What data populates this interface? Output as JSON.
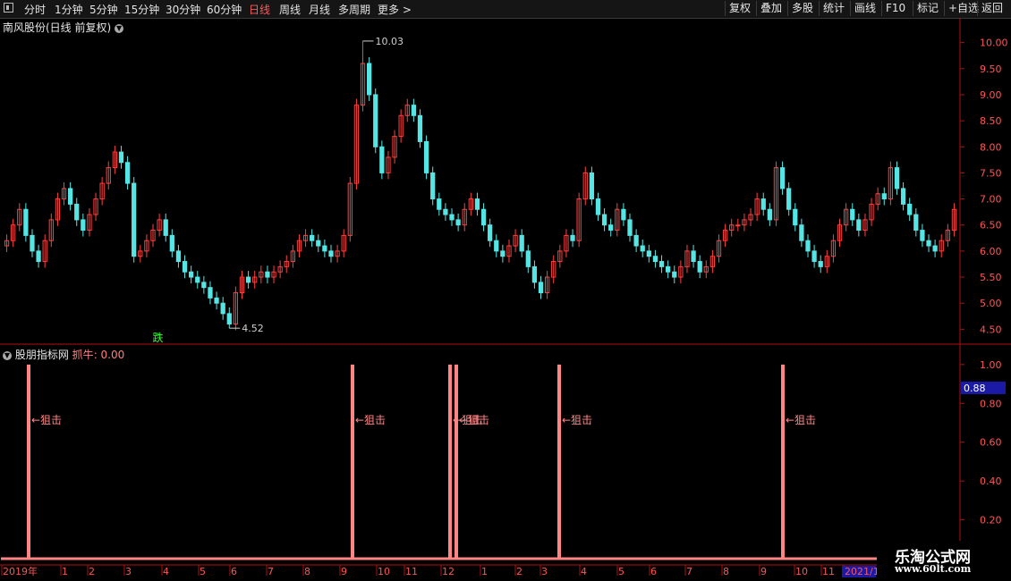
{
  "toolbar": {
    "left_items": [
      "分时",
      "1分钟",
      "5分钟",
      "15分钟",
      "30分钟",
      "60分钟",
      "日线",
      "周线",
      "月线",
      "多周期",
      "更多 >"
    ],
    "active": "日线",
    "right_items": [
      "复权",
      "叠加",
      "多股",
      "统计",
      "画线",
      "F10",
      "标记",
      "+自选",
      "返回"
    ]
  },
  "main_chart": {
    "title": "南风股份(日线 前复权)",
    "max_label": "10.03",
    "min_label": "4.52",
    "signal_text": "跌"
  },
  "indicator": {
    "title": "股朋指标网",
    "name": "抓牛",
    "value": "0.00",
    "current_readout": "0.88",
    "signal_label": "←狙击"
  },
  "brand": {
    "title": "乐淘公式网",
    "url": "www.60lt.com"
  },
  "colors": {
    "up": "#ff4040",
    "down": "#55e5e5",
    "signal": "#ff8585",
    "axis": "#b01010",
    "bg": "#000000"
  },
  "chart_data": [
    {
      "type": "candlestick",
      "title": "南风股份(日线 前复权)",
      "ylim": [
        4.3,
        10.2
      ],
      "yticks": [
        4.5,
        5.0,
        5.5,
        6.0,
        6.5,
        7.0,
        7.5,
        8.0,
        8.5,
        9.0,
        9.5,
        10.0
      ],
      "annotations": [
        {
          "label": "10.03",
          "value": 10.03
        },
        {
          "label": "4.52",
          "value": 4.52
        }
      ],
      "closes": [
        6.2,
        6.5,
        6.8,
        6.3,
        6.0,
        5.8,
        6.2,
        6.6,
        7.0,
        7.2,
        6.9,
        6.6,
        6.4,
        6.7,
        7.0,
        7.3,
        7.6,
        7.9,
        7.7,
        7.3,
        5.9,
        6.0,
        6.2,
        6.4,
        6.6,
        6.3,
        6.0,
        5.8,
        5.6,
        5.5,
        5.4,
        5.3,
        5.1,
        5.0,
        4.8,
        4.6,
        5.2,
        5.5,
        5.4,
        5.5,
        5.6,
        5.5,
        5.6,
        5.7,
        5.8,
        6.0,
        6.2,
        6.3,
        6.2,
        6.1,
        6.0,
        5.9,
        6.0,
        6.3,
        7.3,
        8.8,
        9.6,
        9.0,
        8.0,
        7.5,
        7.8,
        8.2,
        8.6,
        8.8,
        8.6,
        8.1,
        7.5,
        7.0,
        6.8,
        6.7,
        6.6,
        6.5,
        6.8,
        7.0,
        6.8,
        6.5,
        6.2,
        6.0,
        5.9,
        6.1,
        6.3,
        6.0,
        5.7,
        5.4,
        5.2,
        5.5,
        5.8,
        6.0,
        6.3,
        6.2,
        7.0,
        7.5,
        7.0,
        6.7,
        6.5,
        6.4,
        6.8,
        6.6,
        6.3,
        6.1,
        6.0,
        5.9,
        5.8,
        5.7,
        5.6,
        5.5,
        5.7,
        6.0,
        5.8,
        5.6,
        5.7,
        5.9,
        6.2,
        6.4,
        6.5,
        6.5,
        6.6,
        6.7,
        7.0,
        6.8,
        6.6,
        7.6,
        7.2,
        6.8,
        6.5,
        6.2,
        6.0,
        5.8,
        5.7,
        5.9,
        6.2,
        6.5,
        6.8,
        6.6,
        6.4,
        6.6,
        6.9,
        7.1,
        7.0,
        7.6,
        7.2,
        6.9,
        6.7,
        6.4,
        6.2,
        6.1,
        6.0,
        6.2,
        6.4,
        6.8
      ],
      "signal": {
        "label": "跌",
        "index": 24
      }
    },
    {
      "type": "bar",
      "title": "股朋指标网 抓牛",
      "ylim": [
        0,
        1.05
      ],
      "yticks": [
        0.2,
        0.4,
        0.6,
        0.8,
        1.0
      ],
      "current_value": 0.88,
      "bar_positions": [
        32,
        394,
        503,
        510,
        625,
        875
      ],
      "bar_values": [
        1,
        1,
        1,
        1,
        1,
        1
      ],
      "bar_label": "←狙击"
    }
  ],
  "x_axis": {
    "labels": [
      "2019年",
      "1",
      "2",
      "3",
      "4",
      "5",
      "6",
      "7",
      "8",
      "9",
      "10",
      "11",
      "12",
      "1",
      "2",
      "3",
      "4",
      "5",
      "6",
      "7",
      "8",
      "9",
      "10",
      "11",
      "2021/1"
    ],
    "positions": [
      2,
      68,
      98,
      139,
      181,
      222,
      257,
      298,
      339,
      380,
      421,
      452,
      493,
      537,
      576,
      604,
      648,
      690,
      726,
      766,
      807,
      849,
      888,
      918,
      943
    ]
  }
}
